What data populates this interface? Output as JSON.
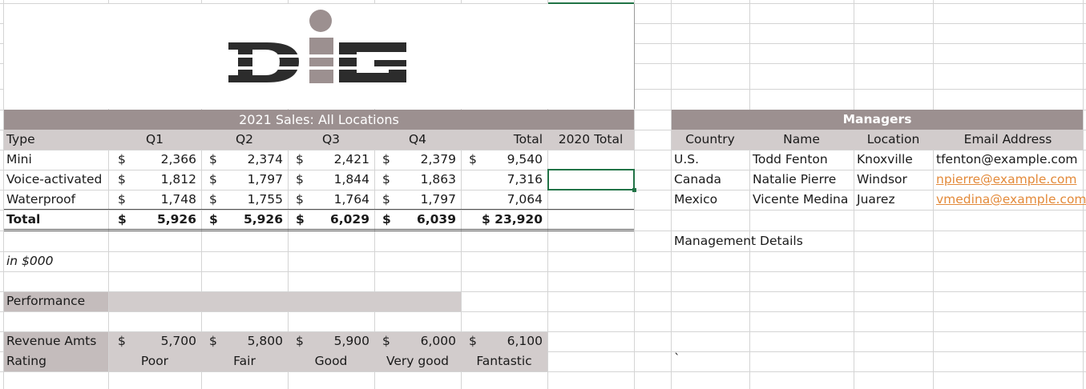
{
  "logo_text": "DiG",
  "sales": {
    "title": "2021 Sales: All Locations",
    "headers": [
      "Type",
      "Q1",
      "Q2",
      "Q3",
      "Q4",
      "Total",
      "2020 Total"
    ],
    "currency": "$",
    "rows": [
      {
        "type": "Mini",
        "q1": "2,366",
        "q2": "2,374",
        "q3": "2,421",
        "q4": "2,379",
        "total": "9,540"
      },
      {
        "type": "Voice-activated",
        "q1": "1,812",
        "q2": "1,797",
        "q3": "1,844",
        "q4": "1,863",
        "total": "7,316"
      },
      {
        "type": "Waterproof",
        "q1": "1,748",
        "q2": "1,755",
        "q3": "1,764",
        "q4": "1,797",
        "total": "7,064"
      }
    ],
    "total_row": {
      "type": "Total",
      "q1": "5,926",
      "q2": "5,926",
      "q3": "6,029",
      "q4": "6,039",
      "total": "$ 23,920"
    },
    "note": "in $000"
  },
  "performance": {
    "label": "Performance",
    "revenue_label": "Revenue Amts",
    "rating_label": "Rating",
    "amounts": [
      "5,700",
      "5,800",
      "5,900",
      "6,000",
      "6,100"
    ],
    "ratings": [
      "Poor",
      "Fair",
      "Good",
      "Very good",
      "Fantastic"
    ]
  },
  "managers": {
    "title": "Managers",
    "headers": [
      "Country",
      "Name",
      "Location",
      "Email Address"
    ],
    "rows": [
      {
        "country": "U.S.",
        "name": "Todd Fenton",
        "location": "Knoxville",
        "email": "tfenton@example.com"
      },
      {
        "country": "Canada",
        "name": "Natalie Pierre",
        "location": "Windsor",
        "email": "npierre@example.com"
      },
      {
        "country": "Mexico",
        "name": "Vicente Medina",
        "location": "Juarez",
        "email": "vmedina@example.com"
      }
    ],
    "details_label": "Management Details",
    "stray_mark": "`"
  },
  "colors": {
    "header_band": "#9c9090",
    "light_band": "#d2cccc",
    "rev_band": "#c4bcbc",
    "selection": "#217346",
    "link": "#e38a3a"
  }
}
